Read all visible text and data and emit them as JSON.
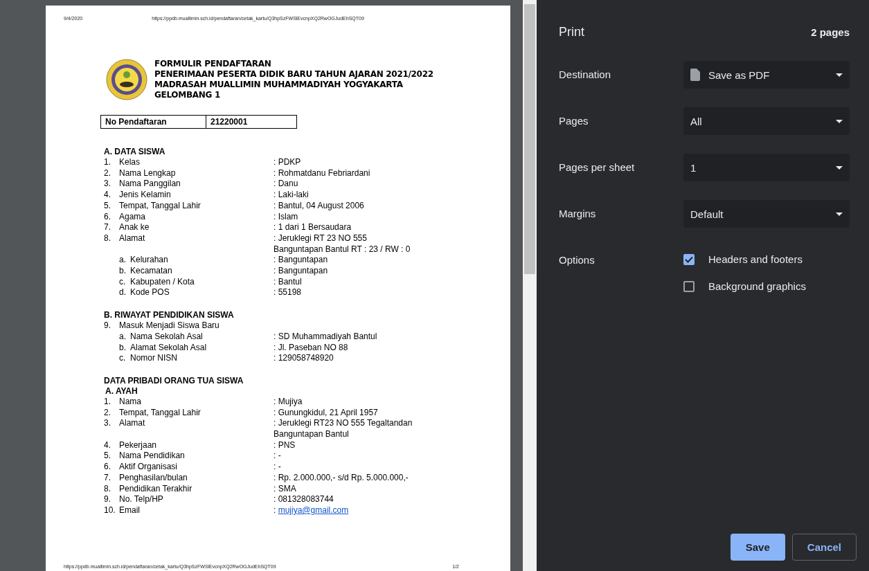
{
  "preview": {
    "header_date": "9/4/2020",
    "header_url": "https://ppdb.muallimin.sch.id/pendaftaran/cetak_kartu/Q3hpSzFWSlEvcnpXQ2RwOGJudEhSQT09",
    "title_lines": [
      "FORMULIR PENDAFTARAN",
      "PENERIMAAN PESERTA DIDIK BARU TAHUN AJARAN 2021/2022",
      "MADRASAH MUALLIMIN MUHAMMADIYAH YOGYAKARTA",
      "GELOMBANG 1"
    ],
    "registration": {
      "label": "No Pendaftaran",
      "value": "21220001"
    },
    "sections": [
      {
        "title": "A.  DATA SISWA",
        "items": [
          {
            "number": "1.",
            "label": "Kelas",
            "value": [
              ": PDKP"
            ]
          },
          {
            "number": "2.",
            "label": "Nama Lengkap",
            "value": [
              ": Rohmatdanu Febriardani"
            ]
          },
          {
            "number": "3.",
            "label": "Nama Panggilan",
            "value": [
              ": Danu"
            ]
          },
          {
            "number": "4.",
            "label": "Jenis Kelamin",
            "value": [
              ": Laki-laki"
            ]
          },
          {
            "number": "5.",
            "label": "Tempat, Tanggal Lahir",
            "value": [
              ": Bantul, 04 August 2006"
            ]
          },
          {
            "number": "6.",
            "label": "Agama",
            "value": [
              ": Islam"
            ]
          },
          {
            "number": "7.",
            "label": "Anak ke",
            "value": [
              ": 1 dari 1 Bersaudara"
            ]
          },
          {
            "number": "8.",
            "label": "Alamat",
            "value": [
              ": Jeruklegi RT 23 NO 555",
              "Banguntapan Bantul RT : 23 / RW : 0"
            ],
            "children": [
              {
                "number": "a.",
                "label": "Kelurahan",
                "value": [
                  ": Banguntapan"
                ]
              },
              {
                "number": "b.",
                "label": "Kecamatan",
                "value": [
                  ": Banguntapan"
                ]
              },
              {
                "number": "c.",
                "label": "Kabupaten / Kota",
                "value": [
                  ": Bantul"
                ]
              },
              {
                "number": "d.",
                "label": "Kode POS",
                "value": [
                  ": 55198"
                ]
              }
            ]
          }
        ]
      },
      {
        "title": "B.  RIWAYAT PENDIDIKAN SISWA",
        "items": [
          {
            "number": "9.",
            "label": "Masuk Menjadi Siswa Baru",
            "value": [],
            "children": [
              {
                "number": "a.",
                "label": "Nama Sekolah Asal",
                "value": [
                  ": SD Muhammadiyah Bantul"
                ]
              },
              {
                "number": "b.",
                "label": "Alamat Sekolah Asal",
                "value": [
                  ": Jl. Paseban NO 88"
                ]
              },
              {
                "number": "c.",
                "label": "Nomor NISN",
                "value": [
                  ": 129058748920"
                ]
              }
            ]
          }
        ]
      },
      {
        "title": "DATA PRIBADI ORANG TUA SISWA",
        "subtitle": "A.  AYAH",
        "items": [
          {
            "number": "1.",
            "label": "Nama",
            "value": [
              ": Mujiya"
            ]
          },
          {
            "number": "2.",
            "label": "Tempat, Tanggal Lahir",
            "value": [
              ": Gunungkidul, 21 April 1957"
            ]
          },
          {
            "number": "3.",
            "label": "Alamat",
            "value": [
              ": Jeruklegi RT23 NO 555 Tegaltandan",
              "Banguntapan Bantul"
            ]
          },
          {
            "number": "4.",
            "label": "Pekerjaan",
            "value": [
              ": PNS"
            ]
          },
          {
            "number": "5.",
            "label": "Nama Pendidikan",
            "value": [
              ": -"
            ]
          },
          {
            "number": "6.",
            "label": "Aktif Organisasi",
            "value": [
              ": -"
            ]
          },
          {
            "number": "7.",
            "label": "Penghasilan/bulan",
            "value": [
              ": Rp. 2.000.000,- s/d Rp. 5.000.000,-"
            ]
          },
          {
            "number": "8.",
            "label": "Pendidikan Terakhir",
            "value": [
              ": SMA"
            ]
          },
          {
            "number": "9.",
            "label": "No. Telp/HP",
            "value": [
              ": 081328083744"
            ]
          },
          {
            "number": "10.",
            "label": "Email",
            "value": [
              ":"
            ],
            "link": "mujiya@gmail.com"
          }
        ]
      }
    ],
    "footer_url": "https://ppdb.muallimin.sch.id/pendaftaran/cetak_kartu/Q3hpSzFWSlEvcnpXQ2RwOGJudEhSQT09",
    "footer_page": "1/2"
  },
  "panel": {
    "title": "Print",
    "page_count": "2 pages",
    "settings": [
      {
        "kind": "destination",
        "label": "Destination",
        "value": "Save as PDF"
      },
      {
        "kind": "select",
        "label": "Pages",
        "value": "All"
      },
      {
        "kind": "select",
        "label": "Pages per sheet",
        "value": "1"
      },
      {
        "kind": "select",
        "label": "Margins",
        "value": "Default"
      },
      {
        "kind": "checkboxes",
        "label": "Options",
        "options": [
          {
            "label": "Headers and footers",
            "checked": true
          },
          {
            "label": "Background graphics",
            "checked": false
          }
        ]
      }
    ],
    "buttons": [
      {
        "kind": "primary",
        "label": "Save"
      },
      {
        "kind": "secondary",
        "label": "Cancel"
      }
    ]
  }
}
